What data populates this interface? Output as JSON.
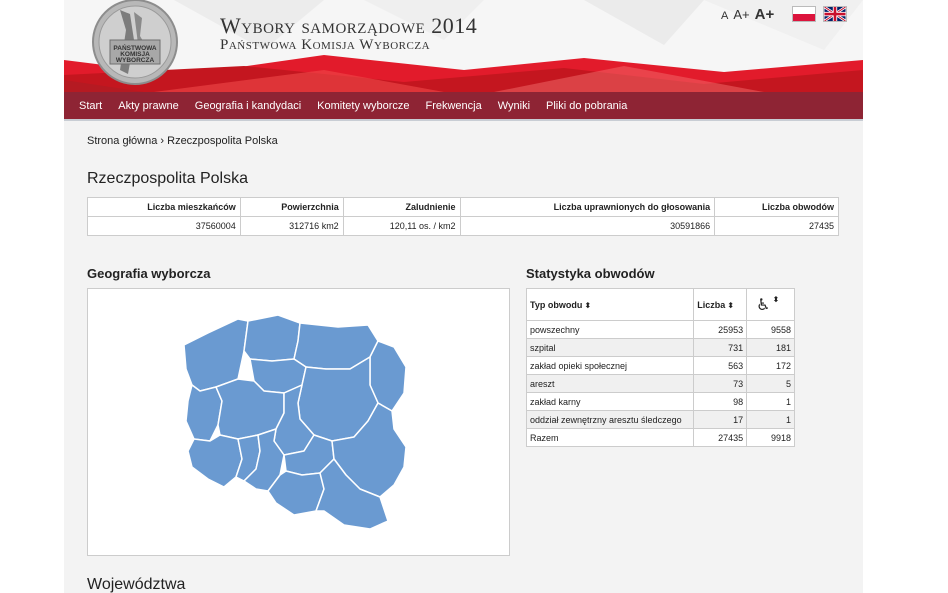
{
  "header": {
    "title": "Wybory samorządowe 2014",
    "subtitle": "Państwowa Komisja Wyborcza",
    "emblem_text": "Państwowa Komisja Wyborcza",
    "font_small": "A",
    "font_medium": "A+",
    "font_large": "A+",
    "flags": [
      "flag-pl",
      "flag-uk"
    ]
  },
  "nav": {
    "items": [
      "Start",
      "Akty prawne",
      "Geografia i kandydaci",
      "Komitety wyborcze",
      "Frekwencja",
      "Wyniki",
      "Pliki do pobrania"
    ]
  },
  "breadcrumb": {
    "home": "Strona główna",
    "separator": "›",
    "current": "Rzeczpospolita Polska"
  },
  "page_title": "Rzeczpospolita Polska",
  "summary": {
    "headers": [
      "Liczba mieszkańców",
      "Powierzchnia",
      "Zaludnienie",
      "Liczba uprawnionych do głosowania",
      "Liczba obwodów"
    ],
    "values": [
      "37560004",
      "312716 km2",
      "120,11 os. / km2",
      "30591866",
      "27435"
    ]
  },
  "geo_title": "Geografia wyborcza",
  "stats": {
    "title": "Statystyka obwodów",
    "headers": [
      "Typ obwodu",
      "Liczba",
      "wheelchair-icon"
    ],
    "rows": [
      [
        "powszechny",
        "25953",
        "9558"
      ],
      [
        "szpital",
        "731",
        "181"
      ],
      [
        "zakład opieki społecznej",
        "563",
        "172"
      ],
      [
        "areszt",
        "73",
        "5"
      ],
      [
        "zakład karny",
        "98",
        "1"
      ],
      [
        "oddział zewnętrzny aresztu śledczego",
        "17",
        "1"
      ],
      [
        "Razem",
        "27435",
        "9918"
      ]
    ]
  },
  "wojewodztwa_title": "Województwa",
  "colors": {
    "nav": "#8e2434",
    "header_red": "#d8232a",
    "map_fill": "#6a9ad1",
    "map_stroke": "#ffffff"
  }
}
